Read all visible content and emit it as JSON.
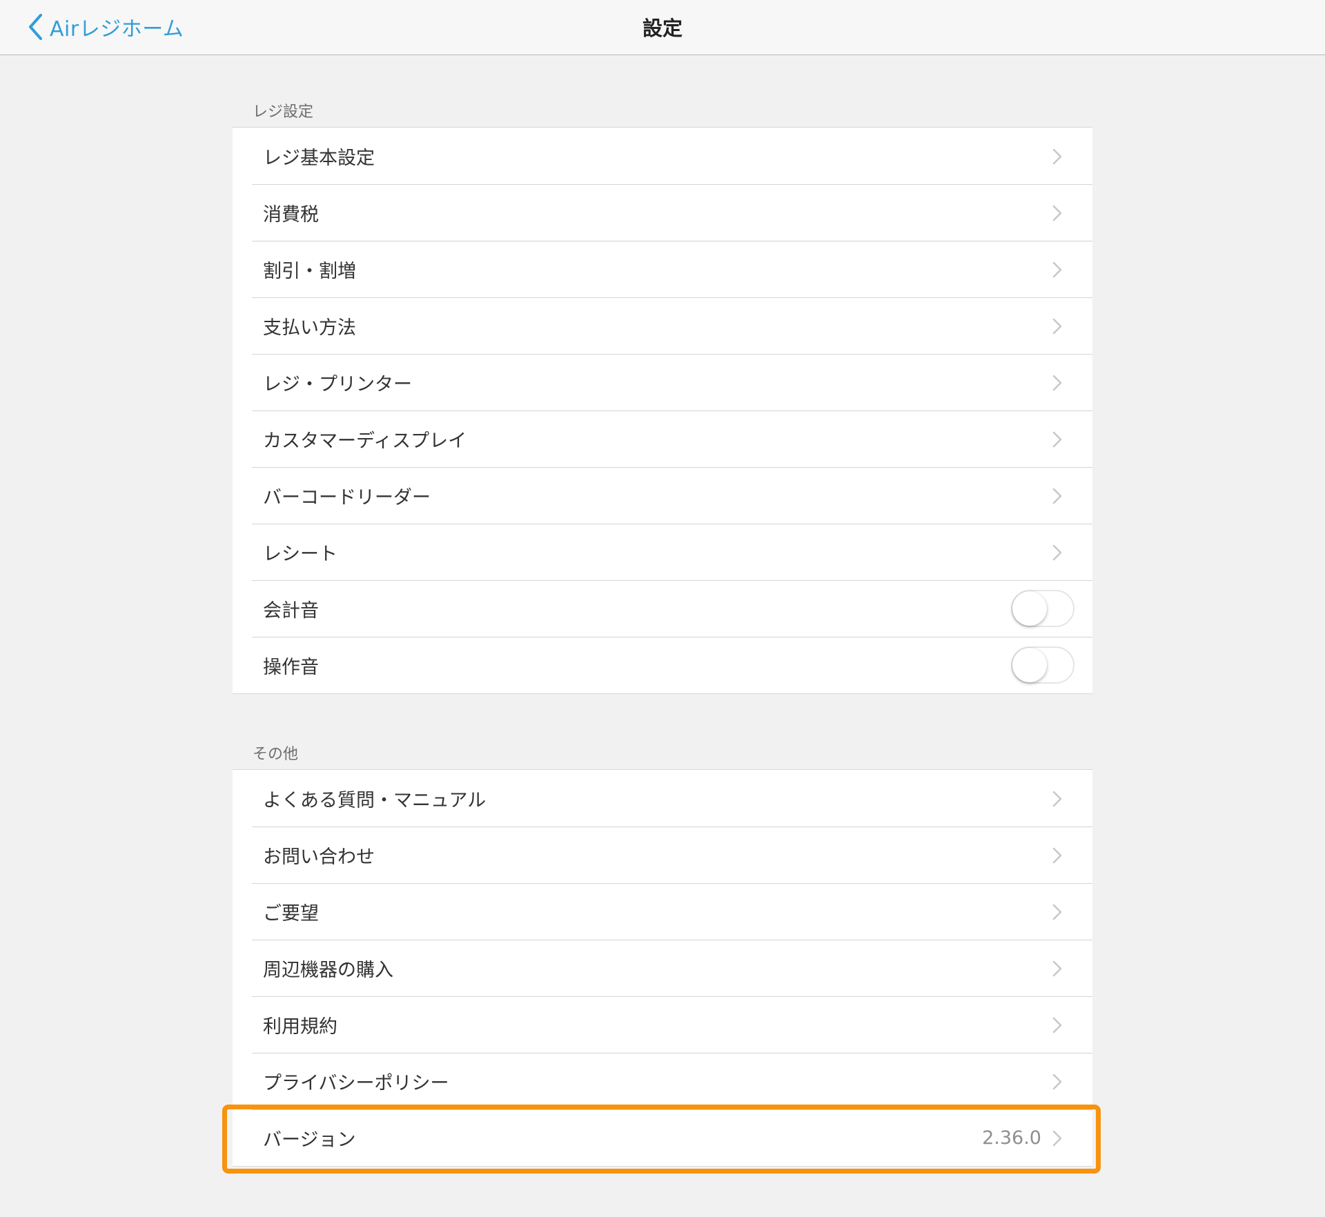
{
  "navbar": {
    "back_label": "Airレジホーム",
    "title": "設定"
  },
  "sections": [
    {
      "header": "レジ設定",
      "rows": [
        {
          "label": "レジ基本設定",
          "type": "link"
        },
        {
          "label": "消費税",
          "type": "link"
        },
        {
          "label": "割引・割増",
          "type": "link"
        },
        {
          "label": "支払い方法",
          "type": "link"
        },
        {
          "label": "レジ・プリンター",
          "type": "link"
        },
        {
          "label": "カスタマーディスプレイ",
          "type": "link"
        },
        {
          "label": "バーコードリーダー",
          "type": "link"
        },
        {
          "label": "レシート",
          "type": "link"
        },
        {
          "label": "会計音",
          "type": "toggle",
          "on": false
        },
        {
          "label": "操作音",
          "type": "toggle",
          "on": false
        }
      ]
    },
    {
      "header": "その他",
      "rows": [
        {
          "label": "よくある質問・マニュアル",
          "type": "link"
        },
        {
          "label": "お問い合わせ",
          "type": "link"
        },
        {
          "label": "ご要望",
          "type": "link"
        },
        {
          "label": "周辺機器の購入",
          "type": "link"
        },
        {
          "label": "利用規約",
          "type": "link"
        },
        {
          "label": "プライバシーポリシー",
          "type": "link"
        },
        {
          "label": "バージョン",
          "type": "link",
          "value": "2.36.0",
          "highlighted": true
        }
      ]
    }
  ],
  "icons": {
    "back": "chevron-left-icon",
    "disclosure": "chevron-right-icon"
  },
  "colors": {
    "accent": "#2f9ed9",
    "highlight": "#f7930e",
    "background": "#f1f1f1"
  }
}
